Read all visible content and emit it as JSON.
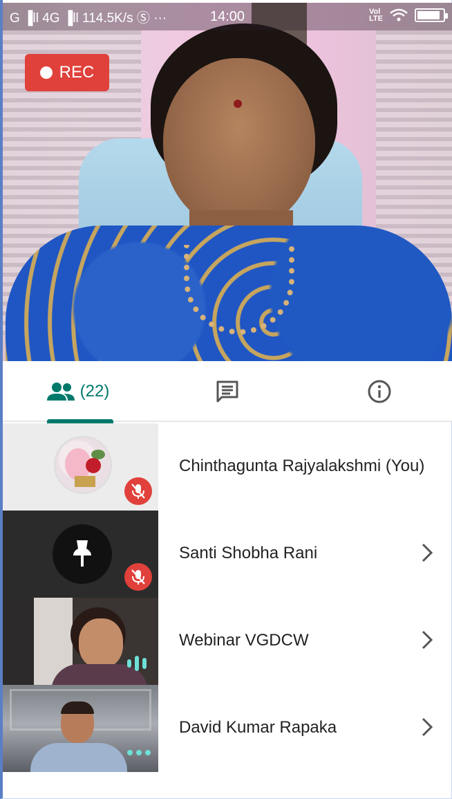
{
  "status_bar": {
    "network": "G ▐ll 4G ▐ll 114.5K/s Ⓢ ···",
    "time": "14:00",
    "right_icons": [
      "volte-lte-icon",
      "wifi-icon",
      "battery-icon"
    ],
    "battery_level": 0.9
  },
  "recording": {
    "label": "REC",
    "color": "#e0413b"
  },
  "tabs": [
    {
      "id": "people",
      "icon": "people-icon",
      "label": "(22)",
      "active": true
    },
    {
      "id": "chat",
      "icon": "chat-icon",
      "label": ""
    },
    {
      "id": "info",
      "icon": "info-icon",
      "label": ""
    }
  ],
  "participants": [
    {
      "name": "Chinthagunta Rajyalakshmi (You)",
      "tile": "avatar",
      "muted": true,
      "chevron": false
    },
    {
      "name": "Santi Shobha Rani",
      "tile": "pin",
      "muted": true,
      "chevron": true
    },
    {
      "name": "Webinar VGDCW",
      "tile": "video",
      "muted": false,
      "speaking": true,
      "chevron": true
    },
    {
      "name": "David Kumar Rapaka",
      "tile": "video",
      "muted": false,
      "speaking": false,
      "chevron": true
    }
  ],
  "colors": {
    "accent": "#00796b",
    "danger": "#e0413b",
    "audio_indicator": "#6ee0d6"
  }
}
